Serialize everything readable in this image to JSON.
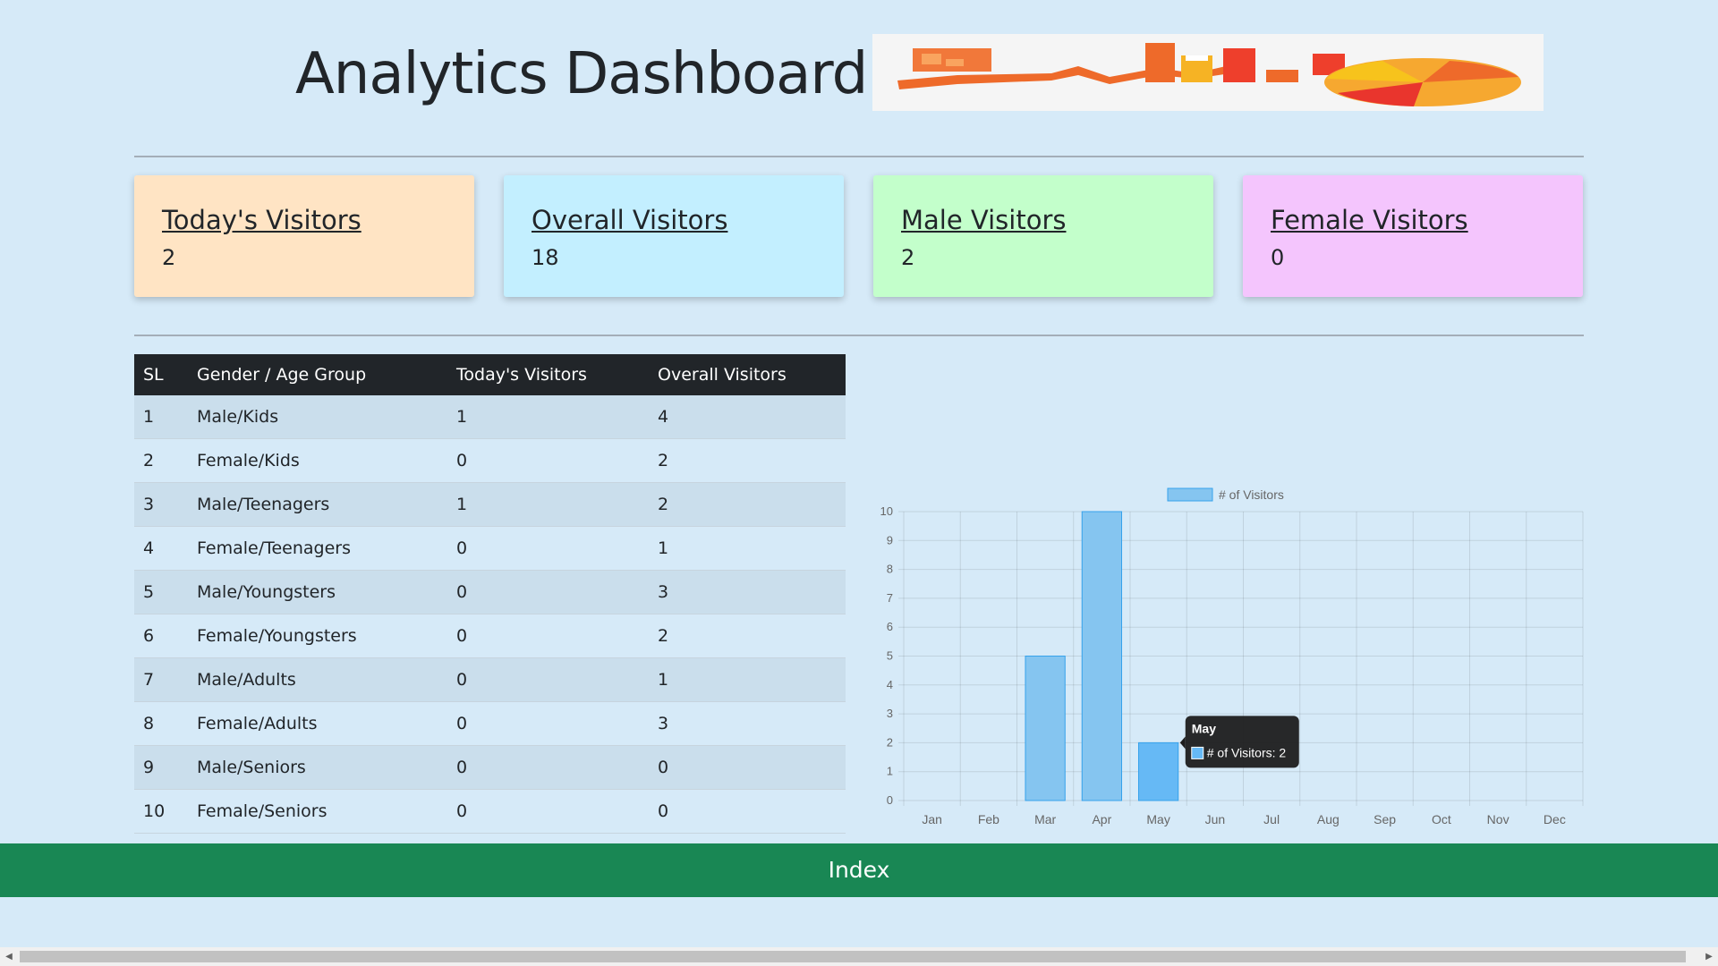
{
  "header": {
    "title": "Analytics Dashboard |"
  },
  "cards": [
    {
      "title": "Today's Visitors",
      "value": "2",
      "color": "#ffe4c4"
    },
    {
      "title": "Overall Visitors",
      "value": "18",
      "color": "#c3efff"
    },
    {
      "title": "Male Visitors",
      "value": "2",
      "color": "#c3ffcb"
    },
    {
      "title": "Female Visitors",
      "value": "0",
      "color": "#f4c5fd"
    }
  ],
  "table": {
    "headers": {
      "sl": "SL",
      "group": "Gender / Age Group",
      "today": "Today's Visitors",
      "overall": "Overall Visitors"
    },
    "rows": [
      {
        "sl": "1",
        "group": "Male/Kids",
        "today": "1",
        "overall": "4"
      },
      {
        "sl": "2",
        "group": "Female/Kids",
        "today": "0",
        "overall": "2"
      },
      {
        "sl": "3",
        "group": "Male/Teenagers",
        "today": "1",
        "overall": "2"
      },
      {
        "sl": "4",
        "group": "Female/Teenagers",
        "today": "0",
        "overall": "1"
      },
      {
        "sl": "5",
        "group": "Male/Youngsters",
        "today": "0",
        "overall": "3"
      },
      {
        "sl": "6",
        "group": "Female/Youngsters",
        "today": "0",
        "overall": "2"
      },
      {
        "sl": "7",
        "group": "Male/Adults",
        "today": "0",
        "overall": "1"
      },
      {
        "sl": "8",
        "group": "Female/Adults",
        "today": "0",
        "overall": "3"
      },
      {
        "sl": "9",
        "group": "Male/Seniors",
        "today": "0",
        "overall": "0"
      },
      {
        "sl": "10",
        "group": "Female/Seniors",
        "today": "0",
        "overall": "0"
      }
    ]
  },
  "chart_data": {
    "type": "bar",
    "categories": [
      "Jan",
      "Feb",
      "Mar",
      "Apr",
      "May",
      "Jun",
      "Jul",
      "Aug",
      "Sep",
      "Oct",
      "Nov",
      "Dec"
    ],
    "series": [
      {
        "name": "# of Visitors",
        "values": [
          0,
          0,
          5,
          10,
          2,
          0,
          0,
          0,
          0,
          0,
          0,
          0
        ]
      }
    ],
    "ylim": [
      0,
      10
    ],
    "yticks": [
      0,
      1,
      2,
      3,
      4,
      5,
      6,
      7,
      8,
      9,
      10
    ],
    "grid": true,
    "legend": "top",
    "bar_color": "#85c5f0",
    "bar_border_color": "#36a2eb",
    "hover_color": "#66b9f5",
    "tooltip": {
      "title": "May",
      "label": "# of Visitors: 2"
    }
  },
  "footer": {
    "label": "Index",
    "color": "#198754"
  },
  "scrollbar": {
    "left_icon": "scroll-left-arrow-icon",
    "right_icon": "scroll-right-arrow-icon"
  }
}
